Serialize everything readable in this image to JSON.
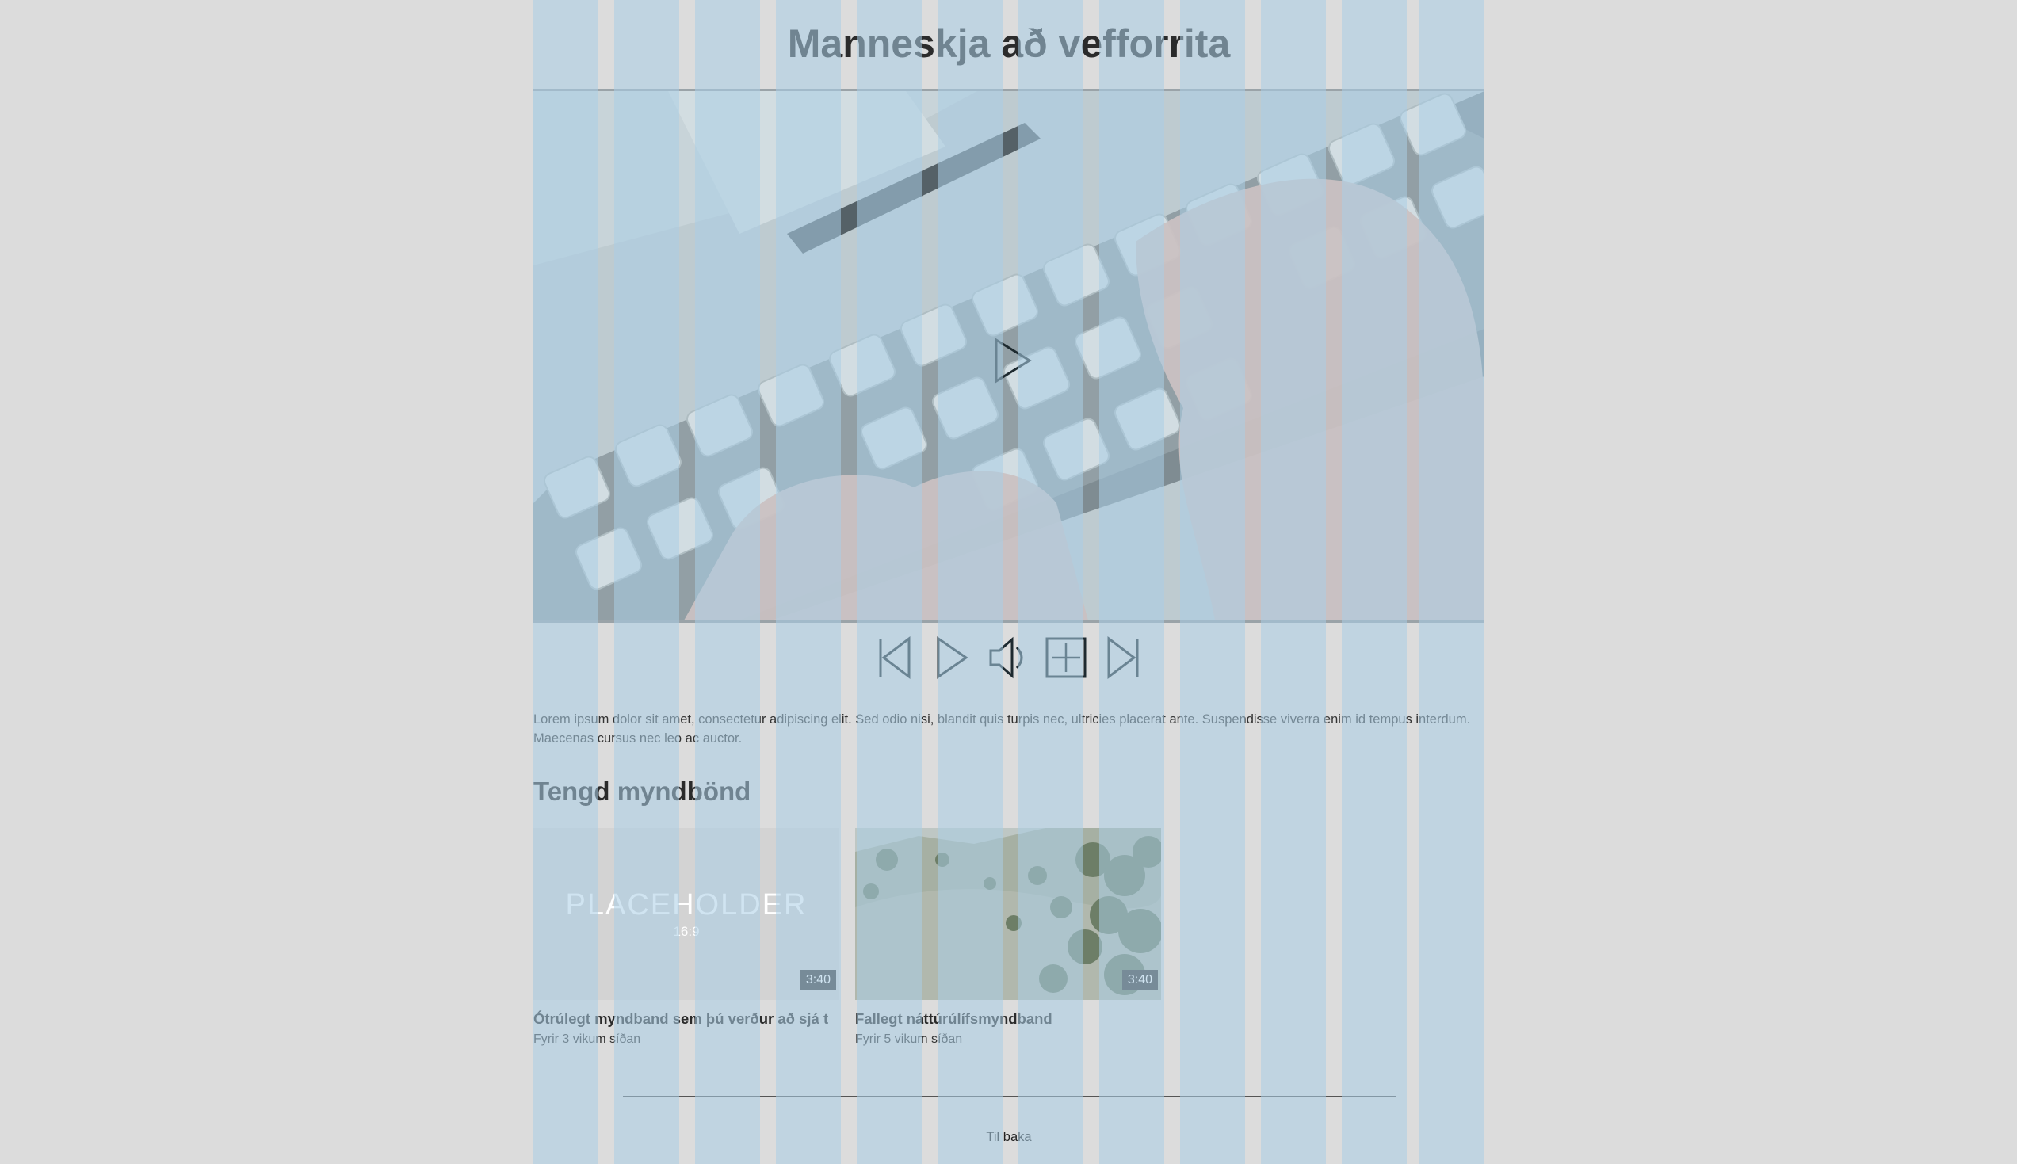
{
  "page": {
    "title": "Manneskja að vefforrita"
  },
  "player": {
    "big_play": "play-icon",
    "controls": [
      {
        "name": "previous-button",
        "icon": "skip-back-icon"
      },
      {
        "name": "play-button",
        "icon": "play-icon"
      },
      {
        "name": "volume-button",
        "icon": "speaker-icon"
      },
      {
        "name": "fullscreen-button",
        "icon": "plus-box-icon"
      },
      {
        "name": "next-button",
        "icon": "skip-forward-icon"
      }
    ]
  },
  "description": "Lorem ipsum dolor sit amet, consectetur adipiscing elit. Sed odio nisi, blandit quis turpis nec, ultricies placerat ante. Suspendisse viverra enim id tempus interdum. Maecenas cursus nec leo ac auctor.",
  "related": {
    "heading": "Tengd myndbönd",
    "items": [
      {
        "title": "Ótrúlegt myndband sem þú verður að sjá t",
        "meta": "Fyrir 3 vikum síðan",
        "duration": "3:40",
        "placeholder_title": "PLACEHOLDER",
        "placeholder_ratio": "16:9"
      },
      {
        "title": "Fallegt náttúrúlífsmyndband",
        "meta": "Fyrir 5 vikum síðan",
        "duration": "3:40"
      }
    ]
  },
  "footer": {
    "back_label": "Til baka"
  },
  "colors": {
    "background": "#dcdcdc",
    "grid_column": "#aacde6",
    "text": "#2b2b2b"
  }
}
